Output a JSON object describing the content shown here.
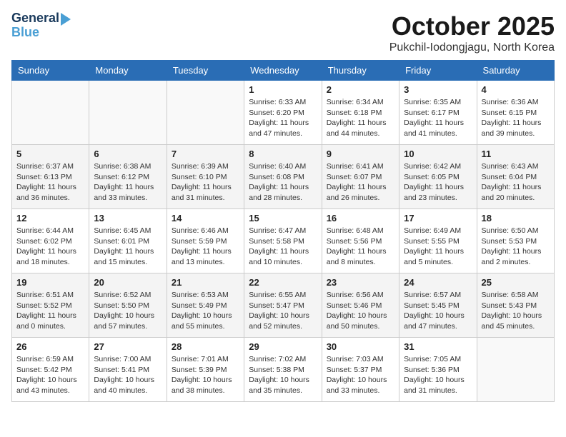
{
  "header": {
    "logo_line1": "General",
    "logo_line2": "Blue",
    "month": "October 2025",
    "location": "Pukchil-Iodongjagu, North Korea"
  },
  "weekdays": [
    "Sunday",
    "Monday",
    "Tuesday",
    "Wednesday",
    "Thursday",
    "Friday",
    "Saturday"
  ],
  "weeks": [
    [
      null,
      null,
      null,
      {
        "day": 1,
        "sunrise": "6:33 AM",
        "sunset": "6:20 PM",
        "daylight": "11 hours and 47 minutes."
      },
      {
        "day": 2,
        "sunrise": "6:34 AM",
        "sunset": "6:18 PM",
        "daylight": "11 hours and 44 minutes."
      },
      {
        "day": 3,
        "sunrise": "6:35 AM",
        "sunset": "6:17 PM",
        "daylight": "11 hours and 41 minutes."
      },
      {
        "day": 4,
        "sunrise": "6:36 AM",
        "sunset": "6:15 PM",
        "daylight": "11 hours and 39 minutes."
      }
    ],
    [
      {
        "day": 5,
        "sunrise": "6:37 AM",
        "sunset": "6:13 PM",
        "daylight": "11 hours and 36 minutes."
      },
      {
        "day": 6,
        "sunrise": "6:38 AM",
        "sunset": "6:12 PM",
        "daylight": "11 hours and 33 minutes."
      },
      {
        "day": 7,
        "sunrise": "6:39 AM",
        "sunset": "6:10 PM",
        "daylight": "11 hours and 31 minutes."
      },
      {
        "day": 8,
        "sunrise": "6:40 AM",
        "sunset": "6:08 PM",
        "daylight": "11 hours and 28 minutes."
      },
      {
        "day": 9,
        "sunrise": "6:41 AM",
        "sunset": "6:07 PM",
        "daylight": "11 hours and 26 minutes."
      },
      {
        "day": 10,
        "sunrise": "6:42 AM",
        "sunset": "6:05 PM",
        "daylight": "11 hours and 23 minutes."
      },
      {
        "day": 11,
        "sunrise": "6:43 AM",
        "sunset": "6:04 PM",
        "daylight": "11 hours and 20 minutes."
      }
    ],
    [
      {
        "day": 12,
        "sunrise": "6:44 AM",
        "sunset": "6:02 PM",
        "daylight": "11 hours and 18 minutes."
      },
      {
        "day": 13,
        "sunrise": "6:45 AM",
        "sunset": "6:01 PM",
        "daylight": "11 hours and 15 minutes."
      },
      {
        "day": 14,
        "sunrise": "6:46 AM",
        "sunset": "5:59 PM",
        "daylight": "11 hours and 13 minutes."
      },
      {
        "day": 15,
        "sunrise": "6:47 AM",
        "sunset": "5:58 PM",
        "daylight": "11 hours and 10 minutes."
      },
      {
        "day": 16,
        "sunrise": "6:48 AM",
        "sunset": "5:56 PM",
        "daylight": "11 hours and 8 minutes."
      },
      {
        "day": 17,
        "sunrise": "6:49 AM",
        "sunset": "5:55 PM",
        "daylight": "11 hours and 5 minutes."
      },
      {
        "day": 18,
        "sunrise": "6:50 AM",
        "sunset": "5:53 PM",
        "daylight": "11 hours and 2 minutes."
      }
    ],
    [
      {
        "day": 19,
        "sunrise": "6:51 AM",
        "sunset": "5:52 PM",
        "daylight": "11 hours and 0 minutes."
      },
      {
        "day": 20,
        "sunrise": "6:52 AM",
        "sunset": "5:50 PM",
        "daylight": "10 hours and 57 minutes."
      },
      {
        "day": 21,
        "sunrise": "6:53 AM",
        "sunset": "5:49 PM",
        "daylight": "10 hours and 55 minutes."
      },
      {
        "day": 22,
        "sunrise": "6:55 AM",
        "sunset": "5:47 PM",
        "daylight": "10 hours and 52 minutes."
      },
      {
        "day": 23,
        "sunrise": "6:56 AM",
        "sunset": "5:46 PM",
        "daylight": "10 hours and 50 minutes."
      },
      {
        "day": 24,
        "sunrise": "6:57 AM",
        "sunset": "5:45 PM",
        "daylight": "10 hours and 47 minutes."
      },
      {
        "day": 25,
        "sunrise": "6:58 AM",
        "sunset": "5:43 PM",
        "daylight": "10 hours and 45 minutes."
      }
    ],
    [
      {
        "day": 26,
        "sunrise": "6:59 AM",
        "sunset": "5:42 PM",
        "daylight": "10 hours and 43 minutes."
      },
      {
        "day": 27,
        "sunrise": "7:00 AM",
        "sunset": "5:41 PM",
        "daylight": "10 hours and 40 minutes."
      },
      {
        "day": 28,
        "sunrise": "7:01 AM",
        "sunset": "5:39 PM",
        "daylight": "10 hours and 38 minutes."
      },
      {
        "day": 29,
        "sunrise": "7:02 AM",
        "sunset": "5:38 PM",
        "daylight": "10 hours and 35 minutes."
      },
      {
        "day": 30,
        "sunrise": "7:03 AM",
        "sunset": "5:37 PM",
        "daylight": "10 hours and 33 minutes."
      },
      {
        "day": 31,
        "sunrise": "7:05 AM",
        "sunset": "5:36 PM",
        "daylight": "10 hours and 31 minutes."
      },
      null
    ]
  ]
}
